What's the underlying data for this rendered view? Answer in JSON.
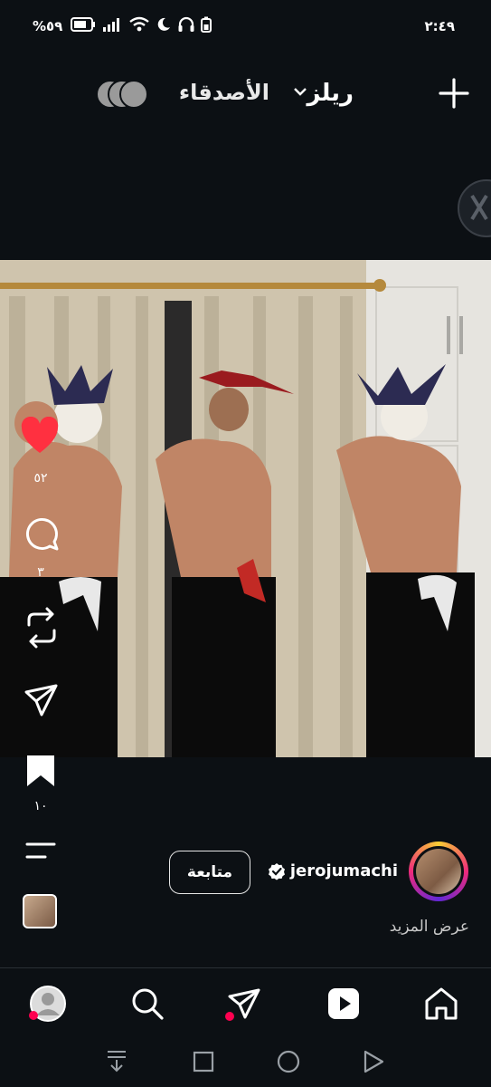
{
  "status_bar": {
    "time": "٢:٤٩",
    "battery_percent": "%٥٩"
  },
  "header": {
    "title": "ريلز",
    "friends_label": "الأصدقاء"
  },
  "actions": {
    "like_count": "٥٢",
    "comment_count": "٣",
    "save_count": "١٠"
  },
  "post": {
    "username": "jerojumachi",
    "follow_label": "متابعة",
    "see_more": "عرض المزيد"
  },
  "colors": {
    "background": "#0c1014",
    "like_red": "#ff3040",
    "notification_dot": "#ff0050"
  }
}
